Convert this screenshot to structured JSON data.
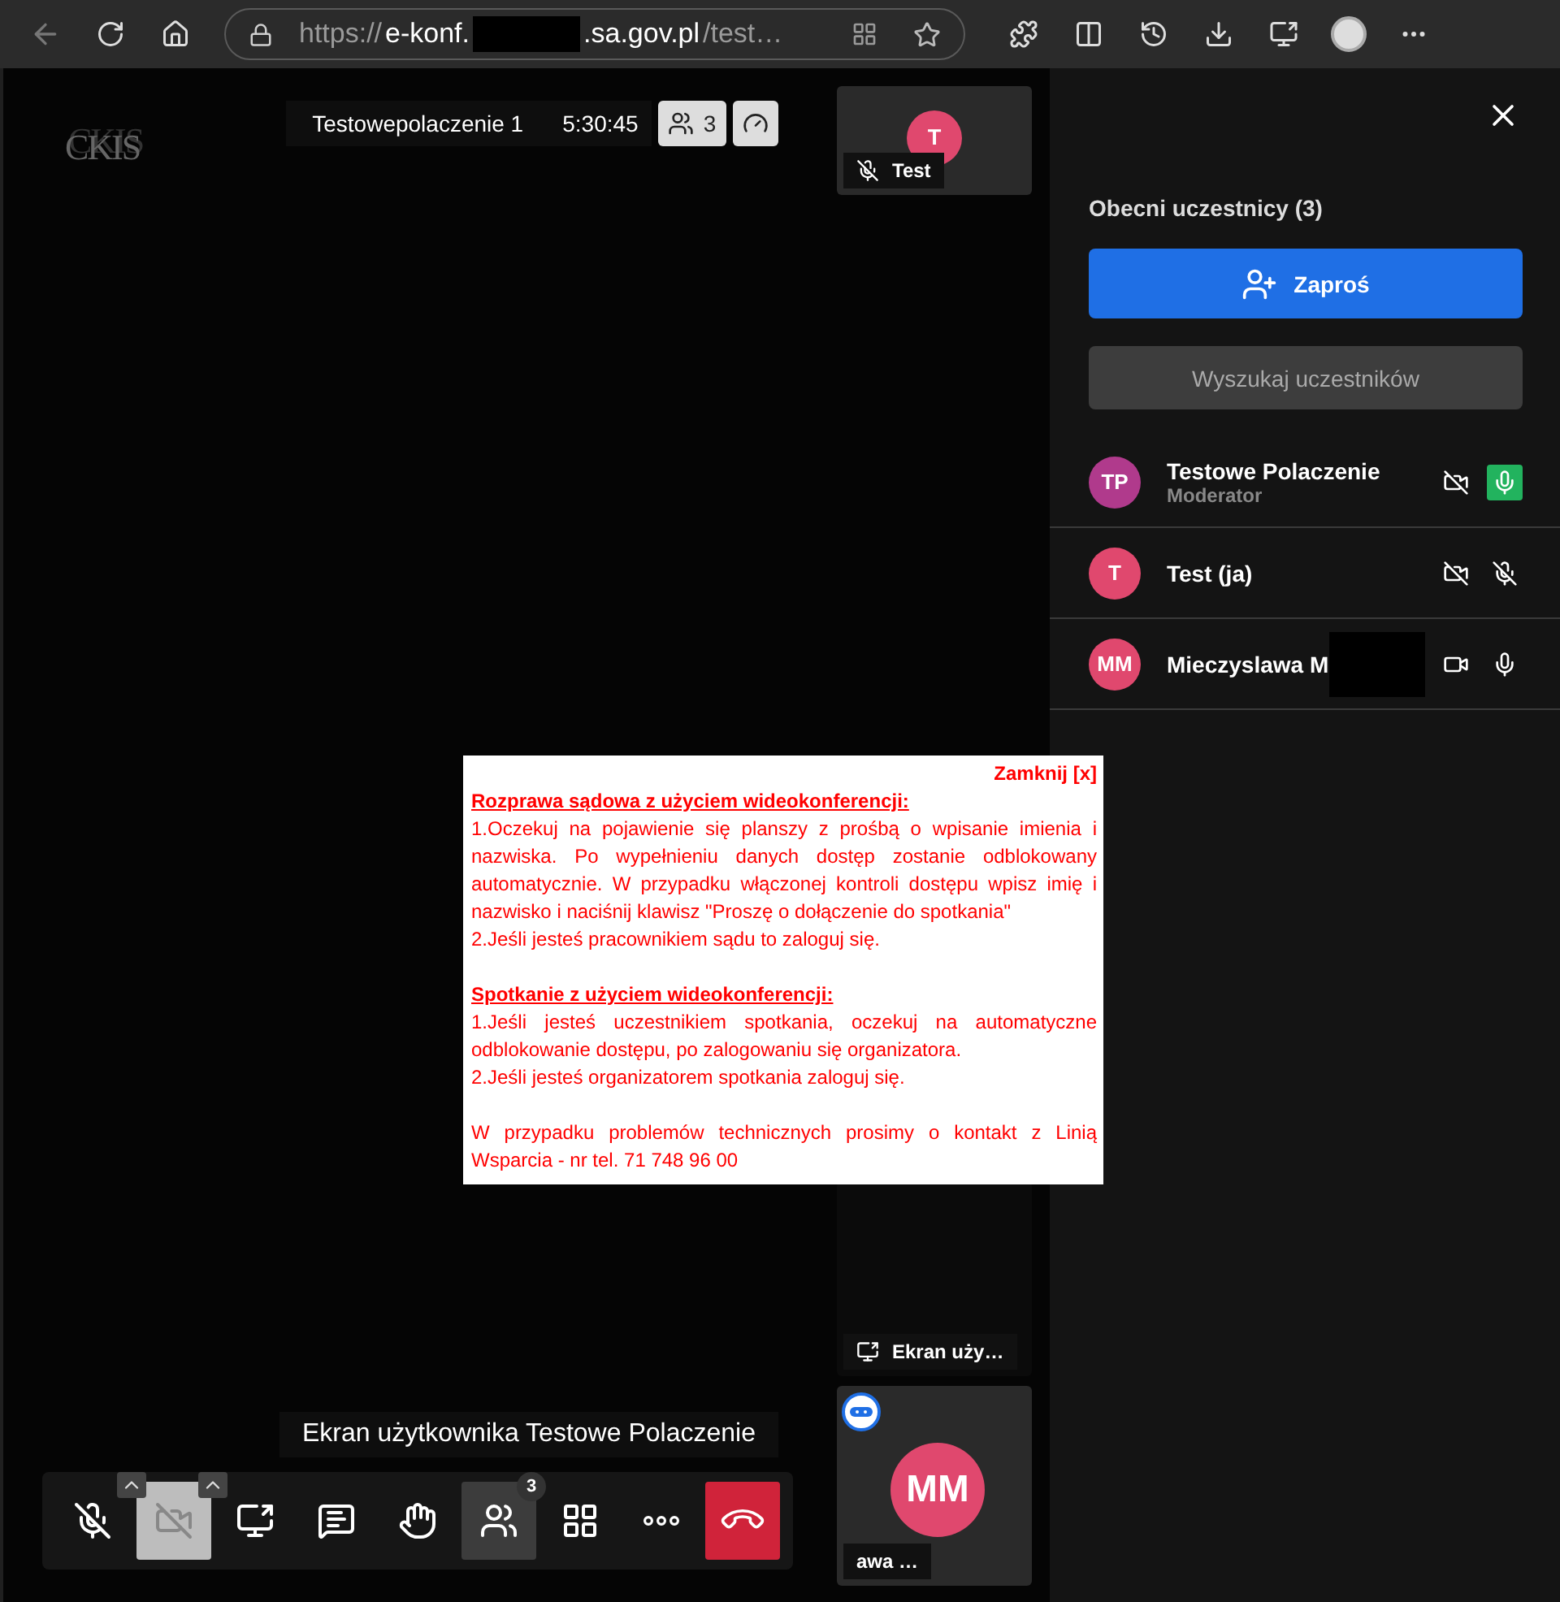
{
  "browser": {
    "url_scheme": "https://",
    "url_host_start": "e-konf.",
    "url_host_end": ".sa.gov.pl",
    "url_path": "/test…"
  },
  "meeting": {
    "logo": "CKIS",
    "title": "Testowepolaczenie 1",
    "time": "5:30:45",
    "participant_count": "3"
  },
  "thumbnails": [
    {
      "kind": "avatar",
      "initials": "T",
      "label": "Test",
      "mic_muted": true,
      "color": "#e0486e"
    },
    {
      "kind": "screen",
      "label": "Ekran uży…"
    },
    {
      "kind": "avatar",
      "initials": "MM",
      "label": "awa …",
      "badge": true,
      "color": "#e0486e"
    }
  ],
  "caption": "Ekran użytkownika Testowe Polaczenie",
  "toolbar": [
    {
      "kind": "mic",
      "off": true,
      "menu": true,
      "selected": false
    },
    {
      "kind": "camera",
      "off": true,
      "menu": true,
      "selected": false
    },
    {
      "kind": "share",
      "menu": false,
      "selected": false
    },
    {
      "kind": "chat",
      "menu": false,
      "selected": false
    },
    {
      "kind": "hand",
      "menu": false,
      "selected": false
    },
    {
      "kind": "participants",
      "menu": false,
      "selected": true,
      "badge": "3"
    },
    {
      "kind": "grid",
      "menu": false,
      "selected": false
    },
    {
      "kind": "more",
      "menu": false,
      "selected": false
    },
    {
      "kind": "hangup",
      "menu": false,
      "selected": false
    }
  ],
  "popup": {
    "close_label": "Zamknij [x]",
    "sections": [
      {
        "heading": "Rozprawa sądowa z użyciem wideokonferencji:",
        "paragraphs": [
          "1.Oczekuj na pojawienie się planszy z prośbą o wpisanie imienia i nazwiska. Po wypełnieniu danych dostęp zostanie odblokowany automatycznie. W przypadku włączonej kontroli dostępu wpisz imię i nazwisko i naciśnij klawisz \"Proszę o dołączenie do spotkania\"",
          "2.Jeśli jesteś pracownikiem sądu to zaloguj się."
        ]
      },
      {
        "heading": "Spotkanie z użyciem wideokonferencji:",
        "paragraphs": [
          "1.Jeśli jesteś uczestnikiem spotkania, oczekuj na automatyczne odblokowanie dostępu, po zalogowaniu się organizatora.",
          "2.Jeśli jesteś organizatorem spotkania zaloguj się."
        ]
      }
    ],
    "footer": "W przypadku problemów technicznych prosimy o kontakt z Linią Wsparcia - nr tel. 71 748 96 00"
  },
  "sidebar": {
    "heading": "Obecni uczestnicy (3)",
    "invite_button": "Zaproś",
    "search": {
      "placeholder": "Wyszukaj uczestników"
    },
    "participants": [
      {
        "initials": "TP",
        "name": "Testowe Polaczenie",
        "role": "Moderator",
        "color": "#b03a8c",
        "camera_on": false,
        "mic_muted": false,
        "speaking": true,
        "redacted": false
      },
      {
        "initials": "T",
        "name": "Test (ja)",
        "color": "#e0486e",
        "camera_on": false,
        "mic_muted": true,
        "speaking": false,
        "redacted": false
      },
      {
        "initials": "MM",
        "name": "Mieczyslawa M",
        "color": "#e0486e",
        "camera_on": true,
        "mic_muted": false,
        "speaking": false,
        "redacted": true
      }
    ]
  }
}
